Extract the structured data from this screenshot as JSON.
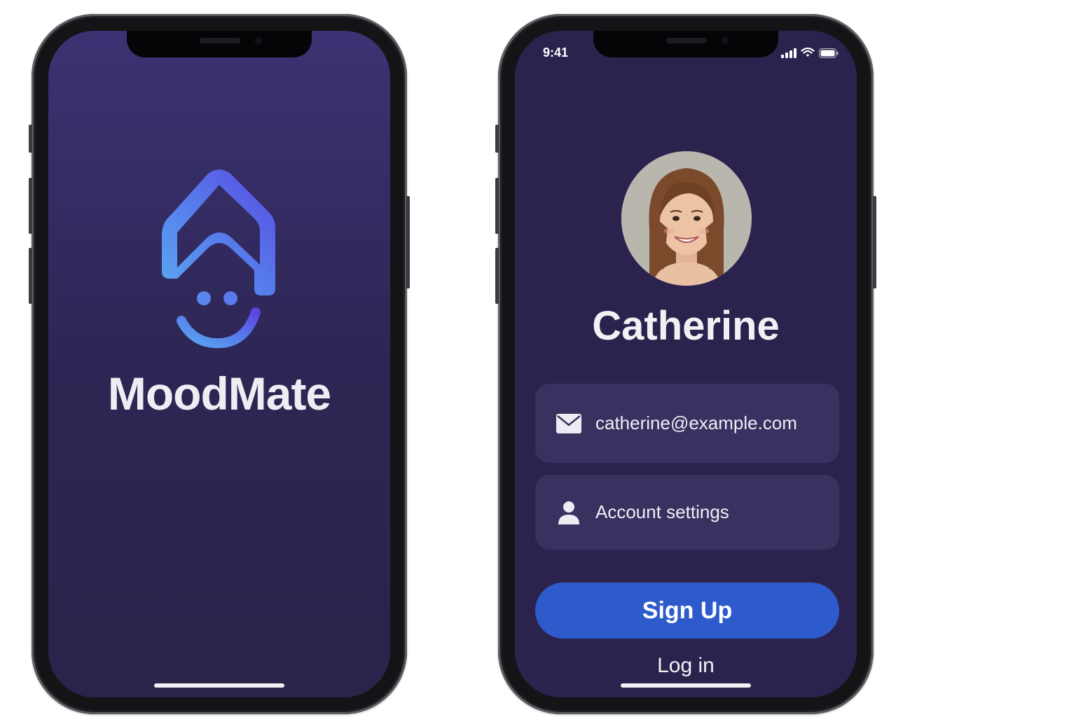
{
  "splash": {
    "app_name": "MoodMate",
    "logo_icon": "moodmate-logo-icon",
    "accent_gradient": [
      "#5b46e0",
      "#5aa7f2"
    ]
  },
  "login": {
    "status_bar": {
      "time": "9:41",
      "icons": [
        "signal-icon",
        "wifi-icon",
        "battery-icon"
      ]
    },
    "profile": {
      "name": "Catherine",
      "avatar_icon": "profile-photo"
    },
    "email_field": {
      "icon": "mail-icon",
      "value": "catherine@example.com"
    },
    "account_settings": {
      "icon": "person-icon",
      "label": "Account settings"
    },
    "signup_label": "Sign Up",
    "login_label": "Log in",
    "colors": {
      "background": "#2b234d",
      "field": "#3a3160",
      "primary_button": "#2e5bcb"
    }
  }
}
